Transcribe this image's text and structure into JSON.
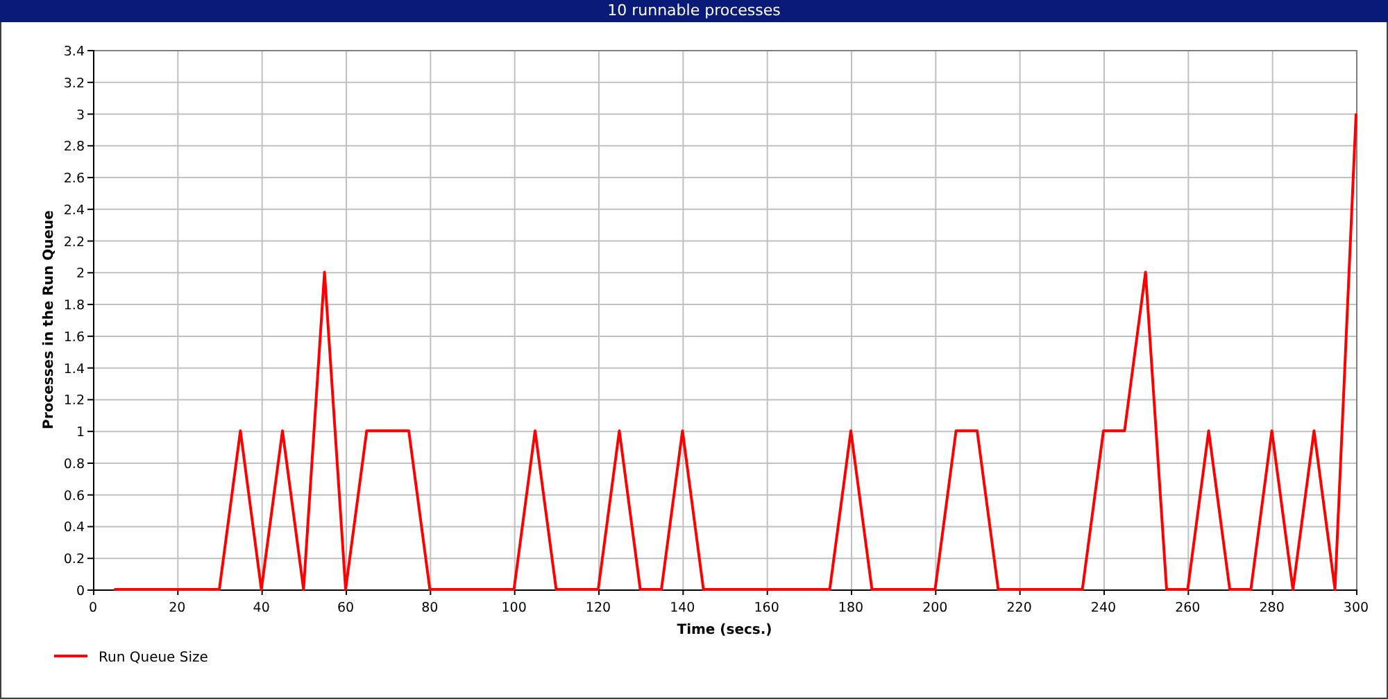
{
  "window": {
    "title": "10 runnable processes"
  },
  "chart": {
    "chart_data": {
      "type": "line",
      "xlabel": "Time (secs.)",
      "ylabel": "Processes in the Run Queue",
      "x": [
        5,
        10,
        15,
        20,
        25,
        30,
        35,
        40,
        45,
        50,
        55,
        60,
        65,
        70,
        75,
        80,
        85,
        90,
        95,
        100,
        105,
        110,
        115,
        120,
        125,
        130,
        135,
        140,
        145,
        150,
        155,
        160,
        165,
        170,
        175,
        180,
        185,
        190,
        195,
        200,
        205,
        210,
        215,
        220,
        225,
        230,
        235,
        240,
        245,
        250,
        255,
        260,
        265,
        270,
        275,
        280,
        285,
        290,
        295,
        300
      ],
      "series": [
        {
          "name": "Run Queue Size",
          "color": "#ff0000",
          "values": [
            0,
            0,
            0,
            0,
            0,
            0,
            1,
            0,
            1,
            0,
            2,
            0,
            1,
            1,
            1,
            0,
            0,
            0,
            0,
            0,
            1,
            0,
            0,
            0,
            1,
            0,
            0,
            1,
            0,
            0,
            0,
            0,
            0,
            0,
            0,
            1,
            0,
            0,
            0,
            0,
            1,
            1,
            0,
            0,
            0,
            0,
            0,
            1,
            1,
            2,
            0,
            0,
            1,
            0,
            0,
            1,
            0,
            1,
            0,
            3
          ]
        }
      ],
      "grid": true,
      "xlim": [
        0,
        300
      ],
      "ylim": [
        0,
        3.4
      ],
      "xticks": [
        0,
        20,
        40,
        60,
        80,
        100,
        120,
        140,
        160,
        180,
        200,
        220,
        240,
        260,
        280,
        300
      ],
      "yticks": [
        0,
        0.2,
        0.4,
        0.6,
        0.8,
        1,
        1.2,
        1.4,
        1.6,
        1.8,
        2,
        2.2,
        2.4,
        2.6,
        2.8,
        3,
        3.2,
        3.4
      ]
    }
  }
}
